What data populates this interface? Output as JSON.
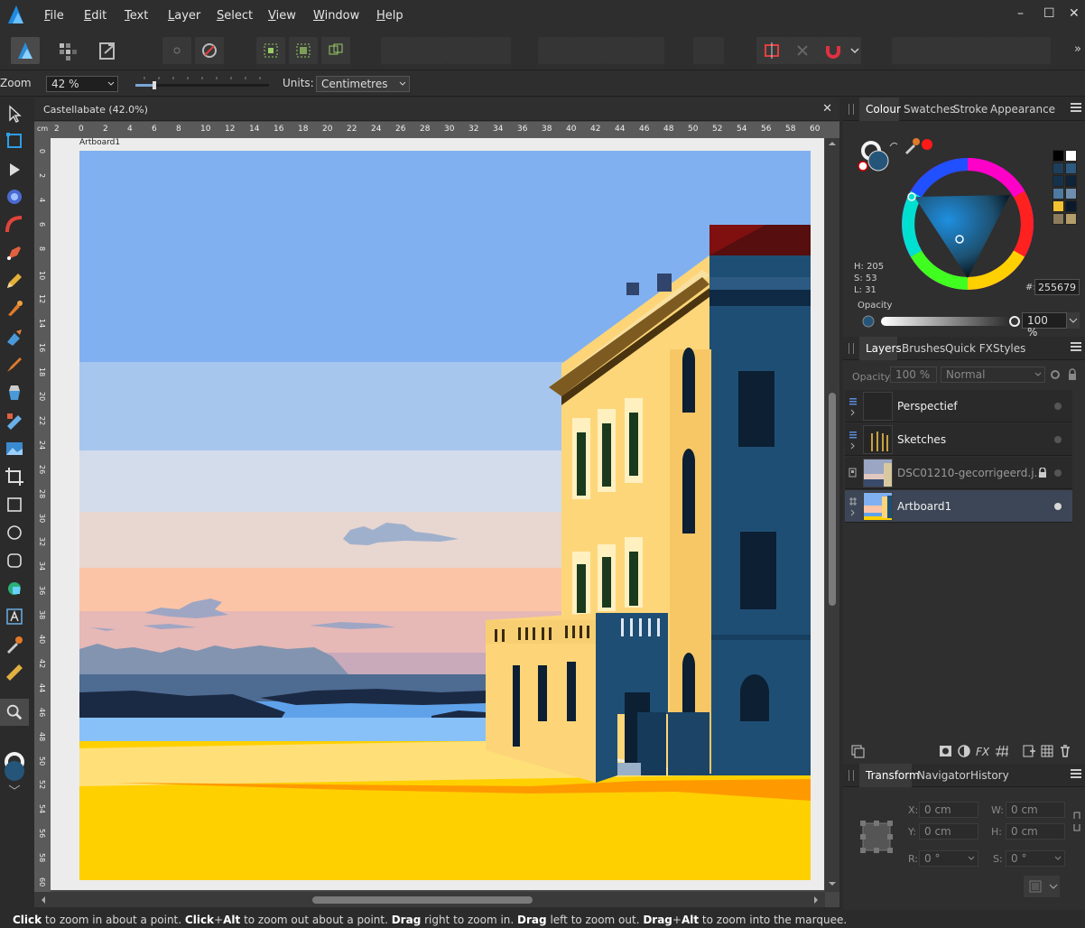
{
  "menubar": {
    "items": [
      "File",
      "Edit",
      "Text",
      "Layer",
      "Select",
      "View",
      "Window",
      "Help"
    ],
    "mnemonics": [
      "F",
      "E",
      "T",
      "L",
      "S",
      "V",
      "W",
      "H"
    ]
  },
  "contextbar": {
    "zoom_label": "Zoom",
    "zoom_value": "42 %",
    "units_label": "Units:",
    "units_value": "Centimetres"
  },
  "document": {
    "tab_title": "Castellabate (42.0%)",
    "artboard_label": "Artboard1",
    "ruler_unit": "cm",
    "h_ticks": [
      "2",
      "0",
      "2",
      "4",
      "6",
      "8",
      "10",
      "12",
      "14",
      "16",
      "18",
      "20",
      "22",
      "24",
      "26",
      "28",
      "30",
      "32",
      "34",
      "36",
      "38",
      "40",
      "42",
      "44",
      "46",
      "48",
      "50",
      "52",
      "54",
      "56",
      "58",
      "60"
    ],
    "v_ticks": [
      "0",
      "2",
      "4",
      "6",
      "8",
      "10",
      "12",
      "14",
      "16",
      "18",
      "20",
      "22",
      "24",
      "26",
      "28",
      "30",
      "32",
      "34",
      "36",
      "38",
      "40",
      "42",
      "44",
      "46",
      "48",
      "50",
      "52",
      "54",
      "56",
      "58",
      "60"
    ]
  },
  "colour_panel": {
    "tabs": [
      "Colour",
      "Swatches",
      "Stroke",
      "Appearance"
    ],
    "active_tab": "Colour",
    "h_label": "H: 205",
    "s_label": "S: 53",
    "l_label": "L: 31",
    "hex_label": "#:",
    "hex_value": "255679",
    "opacity_label": "Opacity",
    "opacity_value": "100 %",
    "current_color": "#255679",
    "swatches": [
      "#000000",
      "#ffffff",
      "#1d3f5c",
      "#2d5a7e",
      "#14324c",
      "#0f2437",
      "#4d7aa0",
      "#6f8fae",
      "#f2c230",
      "#0b1a2a",
      "#8d7c5c",
      "#b39d6a"
    ]
  },
  "layers_panel": {
    "tabs": [
      "Layers",
      "Brushes",
      "Quick FX",
      "Styles"
    ],
    "active_tab": "Layers",
    "opacity_label": "Opacity:",
    "opacity_value": "100 %",
    "blend_mode": "Normal",
    "layers": [
      {
        "name": "Perspectief",
        "visible": true,
        "selected": false,
        "locked": false
      },
      {
        "name": "Sketches",
        "visible": true,
        "selected": false,
        "locked": false
      },
      {
        "name": "DSC01210-gecorrigeerd.j...",
        "visible": false,
        "selected": false,
        "locked": true
      },
      {
        "name": "Artboard1",
        "visible": true,
        "selected": true,
        "locked": false
      }
    ]
  },
  "transform_panel": {
    "tabs": [
      "Transform",
      "Navigator",
      "History"
    ],
    "active_tab": "Transform",
    "x_label": "X:",
    "x_value": "0 cm",
    "y_label": "Y:",
    "y_value": "0 cm",
    "w_label": "W:",
    "w_value": "0 cm",
    "h_label": "H:",
    "h_value": "0 cm",
    "r_label": "R:",
    "r_value": "0 °",
    "s_label": "S:",
    "s_value": "0 °"
  },
  "statusbar": {
    "t1": "Click",
    "t2": " to zoom in about a point. ",
    "t3": "Click",
    "t4": "+",
    "t5": "Alt",
    "t6": " to zoom out about a point. ",
    "t7": "Drag",
    "t8": " right to zoom in. ",
    "t9": "Drag",
    "t10": " left to zoom out. ",
    "t11": "Drag",
    "t12": "+",
    "t13": "Alt",
    "t14": " to zoom into the marquee."
  },
  "colors": {
    "accent": "#2e8fd6",
    "sky_top": "#80b0f0",
    "building_blue": "#1f4e74",
    "building_yellow": "#fdd578",
    "sand": "#ffd000"
  }
}
